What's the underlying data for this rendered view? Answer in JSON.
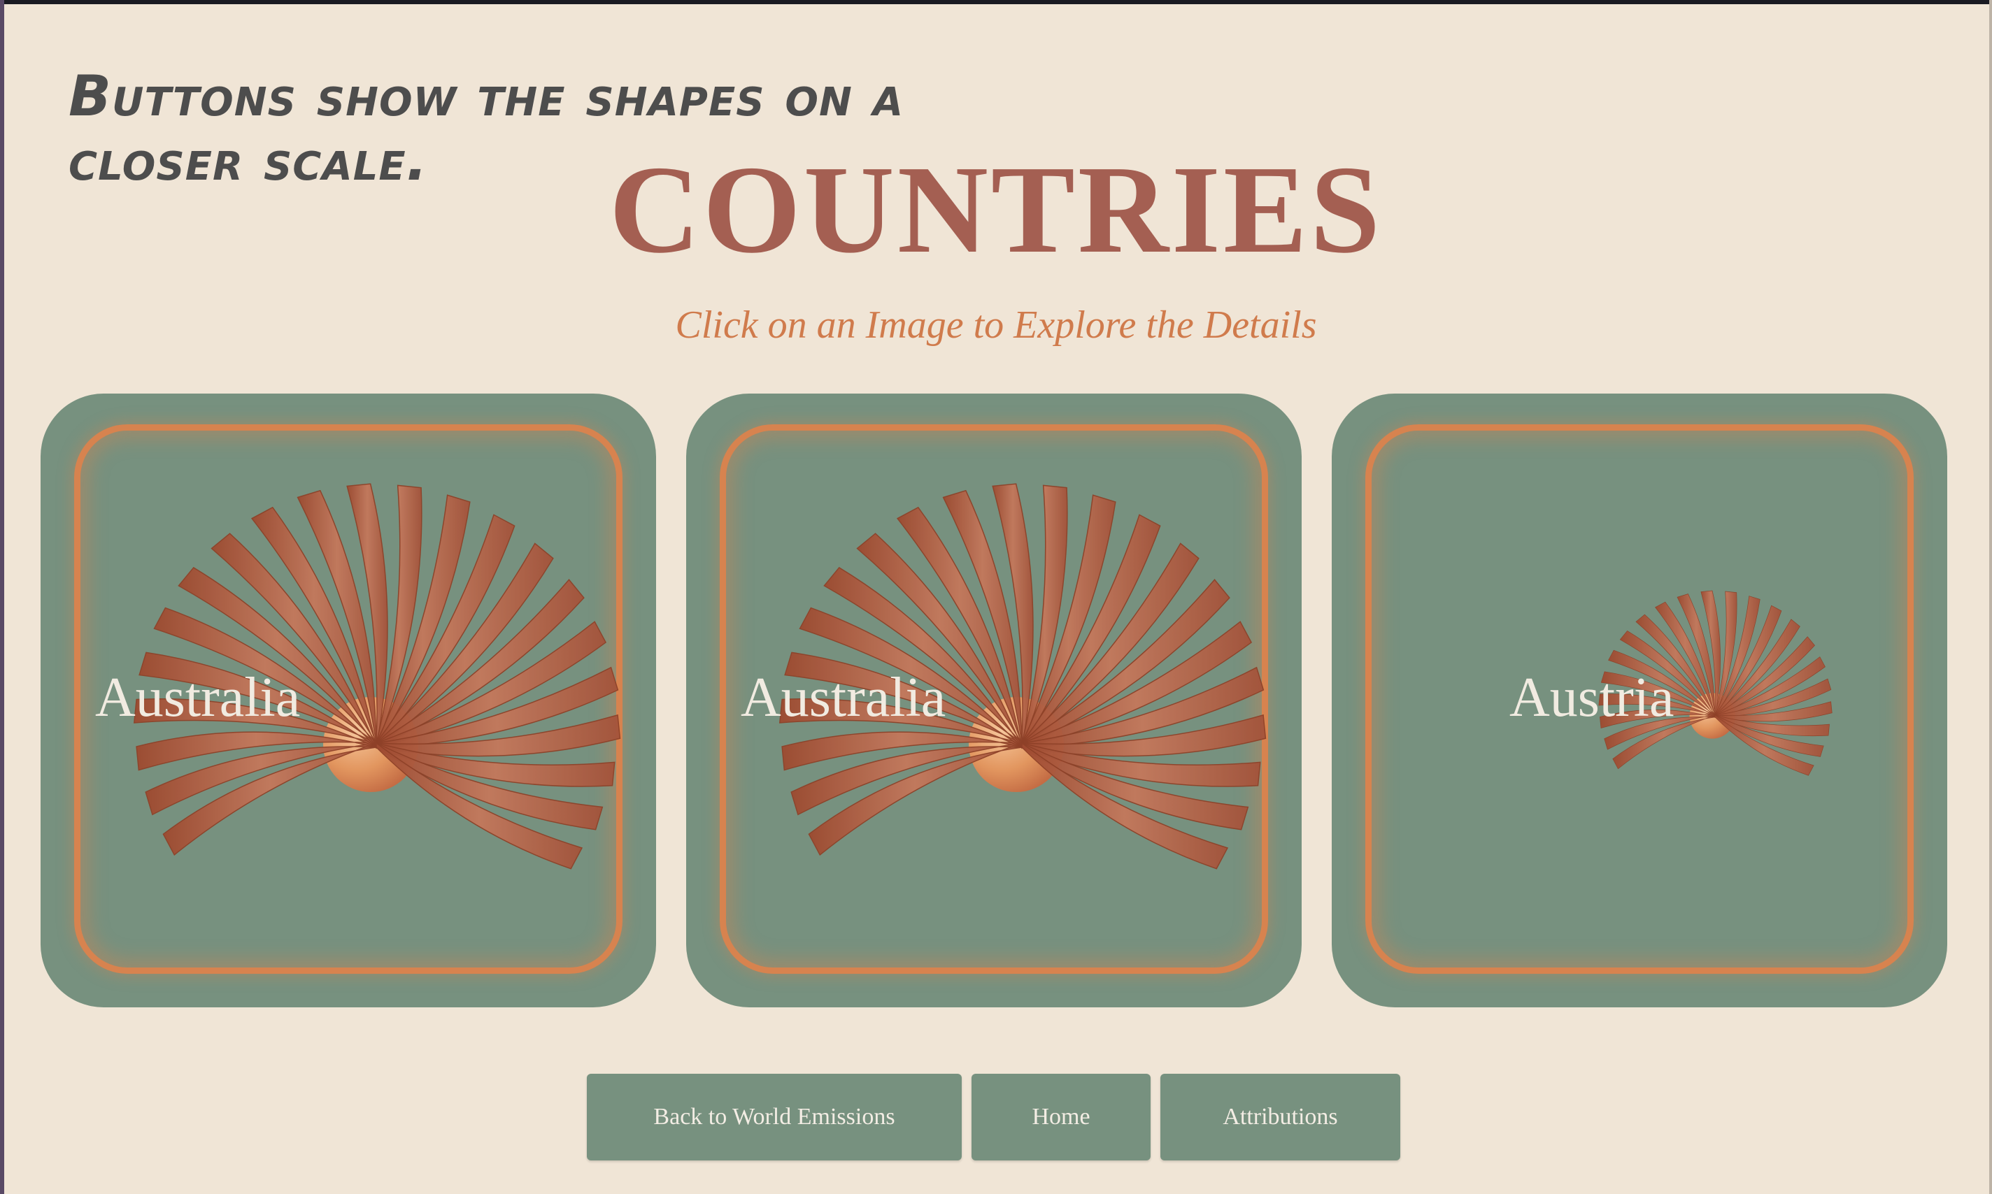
{
  "note": "Buttons show the shapes on a closer scale.",
  "title": "COUNTRIES",
  "subtitle": "Click on an Image to Explore the Details",
  "cards": [
    {
      "label": "Australia"
    },
    {
      "label": "Australia"
    },
    {
      "label": "Austria"
    }
  ],
  "buttons": {
    "back": "Back to World Emissions",
    "home": "Home",
    "attributions": "Attributions"
  },
  "colors": {
    "background": "#f0e5d6",
    "card": "#77917f",
    "accent": "#d7834f",
    "title": "#a45f52",
    "petal": "#a8553a"
  },
  "icons": [
    "petal-fan-icon",
    "sun-orb-icon"
  ]
}
